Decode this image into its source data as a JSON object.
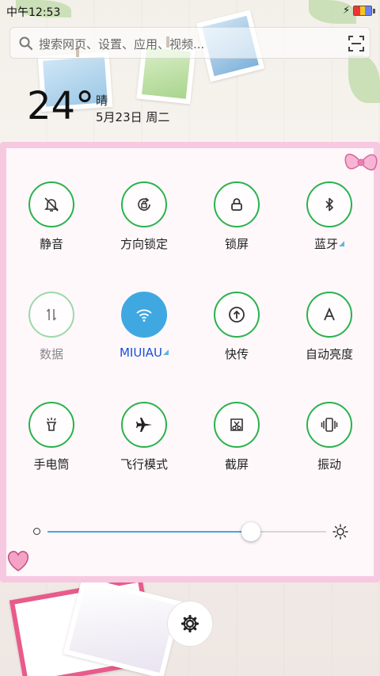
{
  "status_bar": {
    "time": "中午12:53"
  },
  "search": {
    "placeholder": "搜索网页、设置、应用、视频..."
  },
  "weather": {
    "temperature": "24°",
    "condition": "晴",
    "date": "5月23日 周二"
  },
  "quick_settings": {
    "tiles": [
      {
        "label": "静音",
        "icon": "bell-mute-icon",
        "state": "off"
      },
      {
        "label": "方向锁定",
        "icon": "rotation-lock-icon",
        "state": "off"
      },
      {
        "label": "锁屏",
        "icon": "lock-icon",
        "state": "off"
      },
      {
        "label": "蓝牙",
        "icon": "bluetooth-icon",
        "state": "off"
      },
      {
        "label": "数据",
        "icon": "data-arrows-icon",
        "state": "disabled"
      },
      {
        "label": "MIUIAU",
        "icon": "wifi-icon",
        "state": "on"
      },
      {
        "label": "快传",
        "icon": "upload-icon",
        "state": "off"
      },
      {
        "label": "自动亮度",
        "icon": "auto-brightness-icon",
        "state": "off"
      },
      {
        "label": "手电筒",
        "icon": "flashlight-icon",
        "state": "off"
      },
      {
        "label": "飞行模式",
        "icon": "airplane-icon",
        "state": "off"
      },
      {
        "label": "截屏",
        "icon": "screenshot-icon",
        "state": "off"
      },
      {
        "label": "振动",
        "icon": "vibrate-icon",
        "state": "off"
      }
    ],
    "brightness_level": 0.73
  },
  "colors": {
    "accent_green": "#2bb24c",
    "accent_blue": "#3fa8e1",
    "panel_border_pink": "#f7c9e0"
  }
}
